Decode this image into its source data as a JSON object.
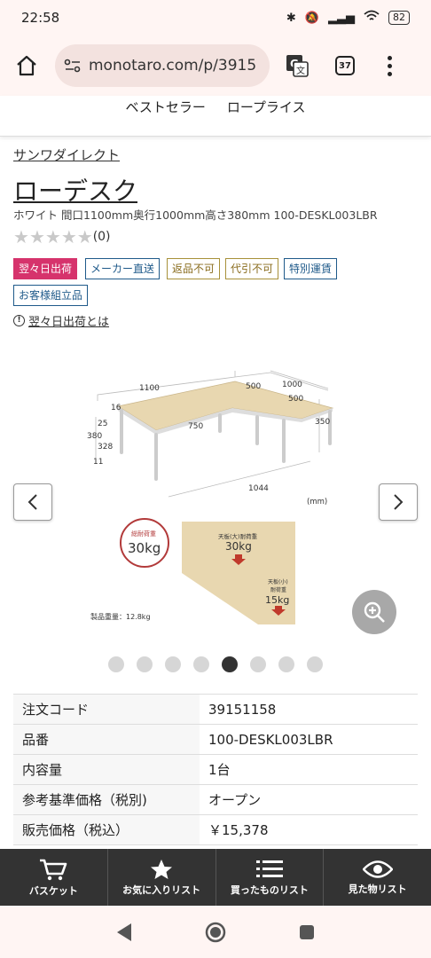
{
  "status": {
    "time": "22:58",
    "battery": "82"
  },
  "browser": {
    "url": "monotaro.com/p/3915",
    "tab_count": "37"
  },
  "topnav": {
    "items": [
      "ベストセラー",
      "ロープライス"
    ]
  },
  "product": {
    "maker": "サンワダイレクト",
    "title": "ローデスク",
    "subtitle": "ホワイト 間口1100mm奥行1000mm高さ380mm 100-DESKL003LBR",
    "rating_count": "(0)",
    "stars": 0,
    "help_link": "翌々日出荷とは",
    "badges": [
      {
        "label": "翌々日出荷",
        "color": "#ffffff",
        "bg": "#d6336c",
        "border": "#d6336c"
      },
      {
        "label": "メーカー直送",
        "color": "#1f5a8a",
        "bg": "#ffffff",
        "border": "#1f5a8a"
      },
      {
        "label": "返品不可",
        "color": "#8a6d1f",
        "bg": "#ffffff",
        "border": "#a8913a"
      },
      {
        "label": "代引不可",
        "color": "#8a6d1f",
        "bg": "#ffffff",
        "border": "#a8913a"
      },
      {
        "label": "特別運賃",
        "color": "#1f5a8a",
        "bg": "#ffffff",
        "border": "#1f5a8a"
      },
      {
        "label": "お客様組立品",
        "color": "#1f5a8a",
        "bg": "#ffffff",
        "border": "#1f5a8a"
      }
    ]
  },
  "image": {
    "dims": {
      "d1100": "1100",
      "d500a": "500",
      "d1000": "1000",
      "d500b": "500",
      "d16": "16",
      "d25": "25",
      "d380": "380",
      "d328": "328",
      "d11": "11",
      "d750": "750",
      "d350": "350",
      "d1044": "1044",
      "unit": "(mm)"
    },
    "load_total_label": "総耐荷重",
    "load_total": "30kg",
    "load_large_label": "天板(大)耐荷重",
    "load_large": "30kg",
    "load_small_label1": "天板(小)",
    "load_small_label2": "耐荷重",
    "load_small": "15kg",
    "weight": "製品重量：12.8kg"
  },
  "carousel": {
    "dot_count": 8,
    "active_index": 4
  },
  "specs": [
    {
      "label": "注文コード",
      "value": "39151158"
    },
    {
      "label": "品番",
      "value": "100-DESKL003LBR"
    },
    {
      "label": "内容量",
      "value": "1台"
    },
    {
      "label": "参考基準価格（税別)",
      "value": "オープン"
    },
    {
      "label": "販売価格（税込）",
      "value": "￥15,378"
    }
  ],
  "bottom_nav": {
    "basket": "バスケット",
    "favorites": "お気に入りリスト",
    "purchased": "買ったものリスト",
    "viewed": "見た物リスト"
  }
}
